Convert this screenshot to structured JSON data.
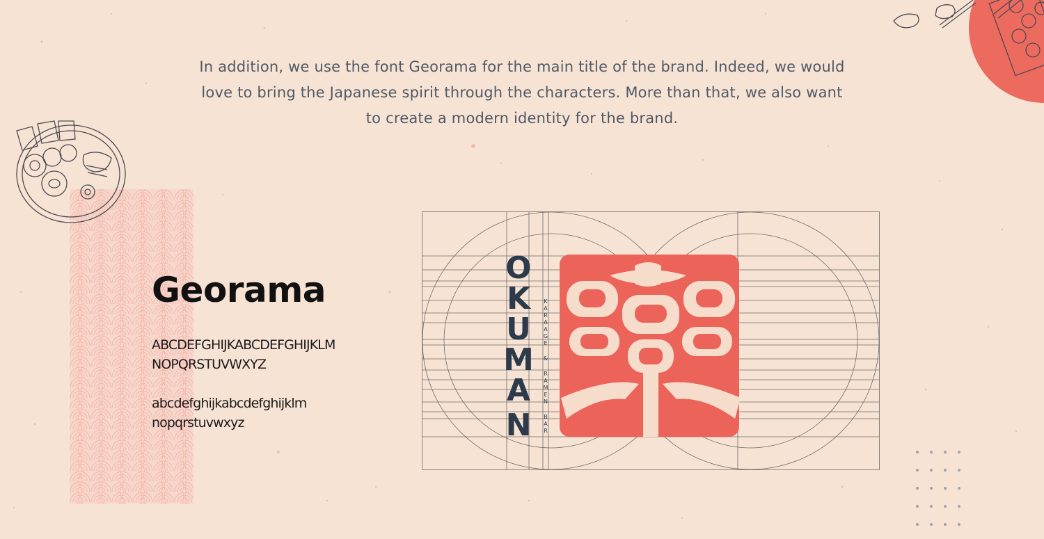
{
  "intro": {
    "line1": "In addition, we use the font Georama for the main title of the brand. Indeed, we would",
    "line2": "love to bring the Japanese spirit through the characters. More than that, we also want",
    "line3": "to create a modern identity for the brand."
  },
  "font_showcase": {
    "name": "Georama",
    "uppercase_line1": "ABCDEFGHIJKABCDEFGHIJKLM",
    "uppercase_line2": "NOPQRSTUVWXYZ",
    "lowercase_line1": "abcdefghijkabcdefghijklm",
    "lowercase_line2": "nopqrstuvwxyz"
  },
  "logo": {
    "wordmark_letters": [
      "O",
      "K",
      "U",
      "M",
      "A",
      "N"
    ],
    "tagline_letters": [
      "K",
      "A",
      "R",
      "A",
      "A",
      "G",
      "E",
      "&",
      "R",
      "A",
      "M",
      "E",
      "N",
      "B",
      "A",
      "R"
    ],
    "wordmark_color": "#2c3a4c",
    "emblem_color": "#ec635a"
  },
  "colors": {
    "background": "#f7e3d4",
    "accent": "#ec6a5e",
    "text": "#4f5966"
  },
  "icons": [
    "ramen-bowl-icon",
    "sushi-tray-icon",
    "seigaiha-wave-pattern",
    "dot-grid-decoration"
  ]
}
